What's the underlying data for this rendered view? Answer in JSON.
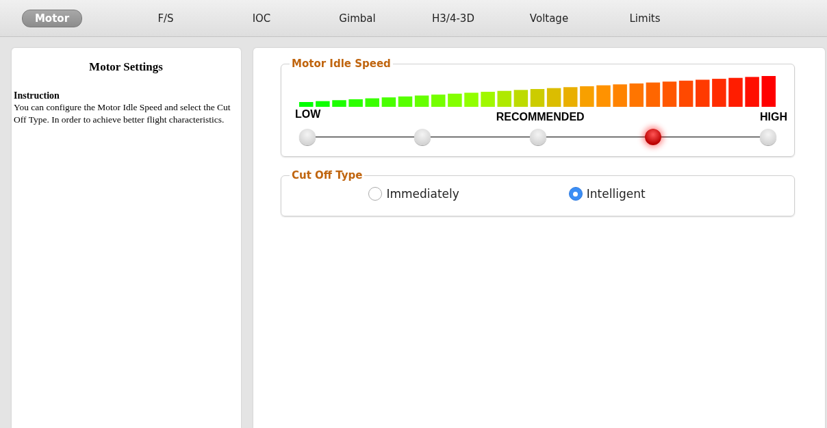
{
  "tabs": [
    {
      "label": "Motor",
      "selected": true
    },
    {
      "label": "F/S",
      "selected": false
    },
    {
      "label": "IOC",
      "selected": false
    },
    {
      "label": "Gimbal",
      "selected": false
    },
    {
      "label": "H3/4-3D",
      "selected": false
    },
    {
      "label": "Voltage",
      "selected": false
    },
    {
      "label": "Limits",
      "selected": false
    }
  ],
  "info_panel": {
    "title": "Motor Settings",
    "heading": "Instruction",
    "text": "You can configure the Motor Idle Speed and select the Cut Off Type. In order to achieve better flight characteristics."
  },
  "idle_speed": {
    "title": "Motor Idle Speed",
    "scale_labels": [
      "LOW",
      "RECOMMENDED",
      "HIGH"
    ],
    "stops": [
      {
        "selected": false
      },
      {
        "selected": false
      },
      {
        "selected": false
      },
      {
        "selected": true
      },
      {
        "selected": false
      }
    ]
  },
  "cut_off": {
    "title": "Cut Off Type",
    "options": [
      {
        "label": "Immediately",
        "selected": false
      },
      {
        "label": "Intelligent",
        "selected": true
      }
    ]
  }
}
